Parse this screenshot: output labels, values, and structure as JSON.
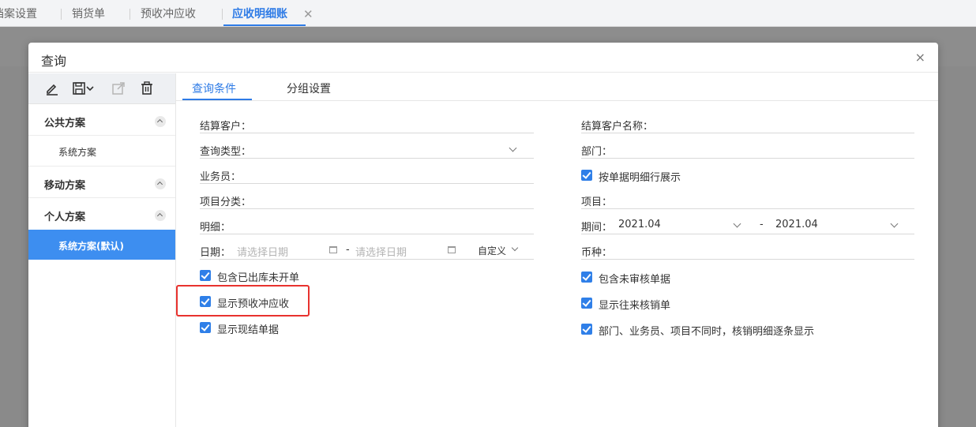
{
  "top_tabs": [
    {
      "label": "档案设置",
      "active": false
    },
    {
      "label": "销货单",
      "active": false
    },
    {
      "label": "预收冲应收",
      "active": false
    },
    {
      "label": "应收明细账",
      "active": true
    }
  ],
  "top_tab_close_glyph": "✕",
  "dialog": {
    "title": "查询",
    "close_glyph": "×"
  },
  "sidebar": {
    "toolbar_icons": [
      "edit-icon",
      "save-icon",
      "export-icon",
      "delete-icon"
    ],
    "groups": [
      {
        "label": "公共方案",
        "items": [
          "系统方案"
        ]
      },
      {
        "label": "移动方案",
        "items": []
      },
      {
        "label": "个人方案",
        "items": [
          "系统方案(默认)"
        ]
      }
    ]
  },
  "main_tabs": [
    {
      "label": "查询条件",
      "active": true
    },
    {
      "label": "分组设置",
      "active": false
    }
  ],
  "left_fields": {
    "customer": "结算客户：",
    "query_type": "查询类型：",
    "salesperson": "业务员：",
    "project_category": "项目分类：",
    "detail": "明细：",
    "date_label": "日期：",
    "date_from_placeholder": "请选择日期",
    "date_sep": "-",
    "date_to_placeholder": "请选择日期",
    "date_mode": "自定义"
  },
  "right_fields": {
    "customer_name": "结算客户名称：",
    "department": "部门：",
    "show_by_detail_row": "按单据明细行展示",
    "project": "项目：",
    "period_label": "期间：",
    "period_from": "2021.04",
    "period_sep": "-",
    "period_to": "2021.04",
    "currency": "币种："
  },
  "left_checkboxes": [
    {
      "label": "包含已出库未开单",
      "checked": true
    },
    {
      "label": "显示预收冲应收",
      "checked": true
    },
    {
      "label": "显示现结单据",
      "checked": true
    }
  ],
  "right_checkboxes": [
    {
      "label": "包含未审核单据",
      "checked": true
    },
    {
      "label": "显示往来核销单",
      "checked": true
    },
    {
      "label": "部门、业务员、项目不同时，核销明细逐条显示",
      "checked": true
    }
  ],
  "colors": {
    "accent": "#2e7be6",
    "active_item_bg": "#3d8ef0",
    "highlight_border": "#e8322e"
  }
}
